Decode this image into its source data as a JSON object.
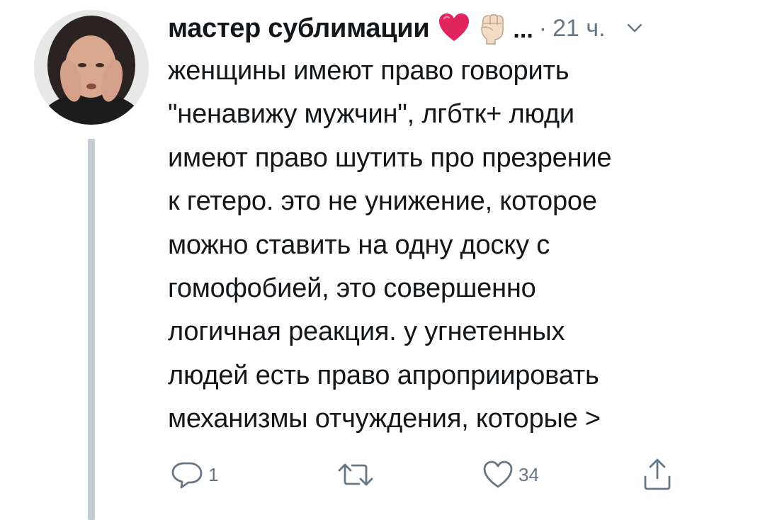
{
  "tweet": {
    "username": "мастер сублимации",
    "badges": [
      "red-heart-icon",
      "raised-fist-icon"
    ],
    "ellipsis": "...",
    "separator": "·",
    "time": "21 ч.",
    "text": "женщины имеют право говорить\n\"ненавижу мужчин\", лгбтк+ люди\nимеют право шутить про презрение\nк гетеро. это не унижение, которое\nможно ставить на одну доску с\nгомофобией, это совершенно\nлогичная реакция. у угнетенных\nлюдей есть право апроприировать\nмеханизмы отчуждения, которые >"
  },
  "actions": {
    "reply_count": "1",
    "retweet_count": "",
    "like_count": "34"
  },
  "colors": {
    "text": "#14171a",
    "muted": "#657786",
    "thread_line": "#c4cbd2",
    "heart": "#e0245e"
  }
}
